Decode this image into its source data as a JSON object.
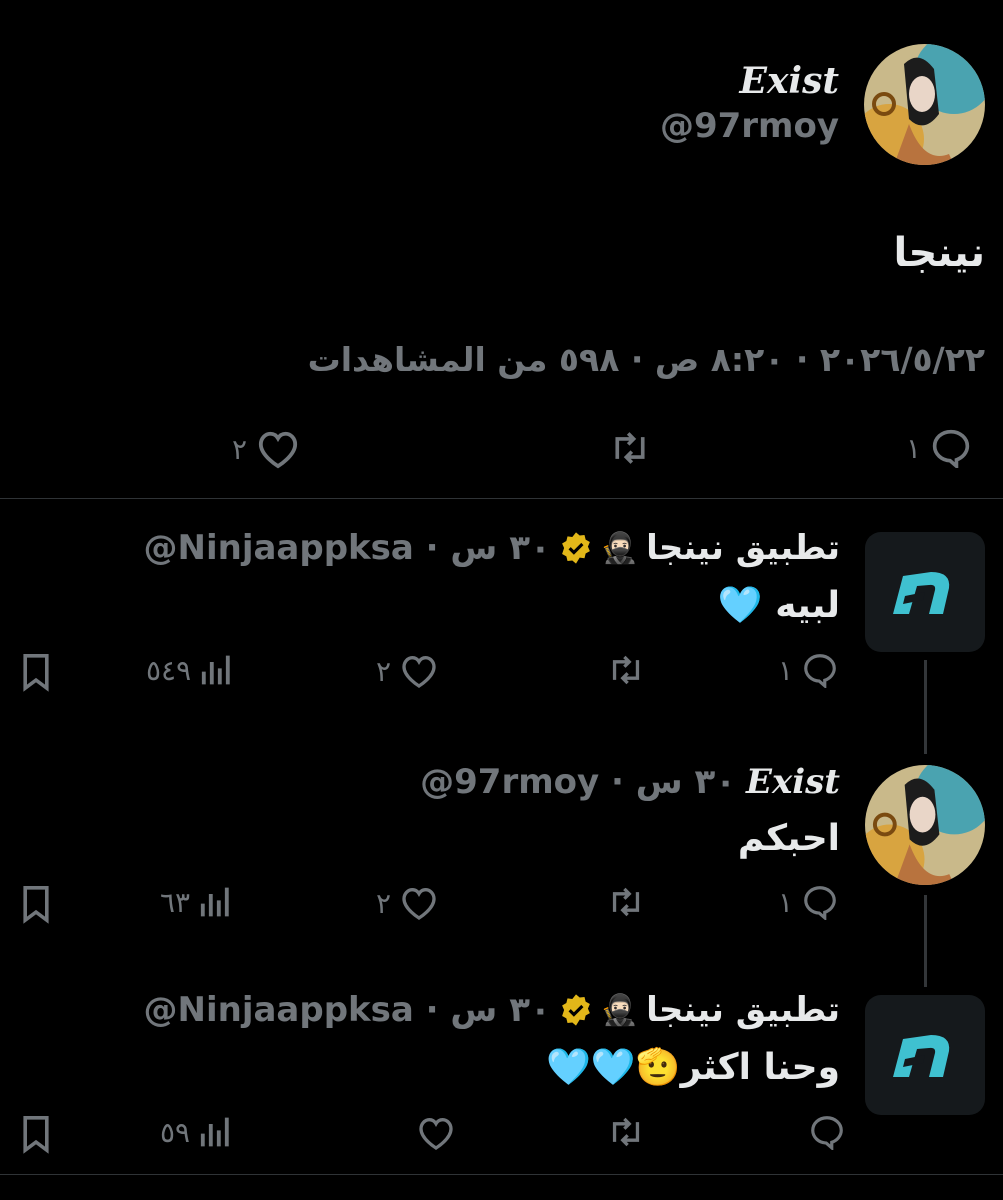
{
  "main_tweet": {
    "display_name": "Exist",
    "handle": "@97rmoy",
    "text": "نينجا",
    "meta": "٢٠٢٦/٥/٢٢ · ٨:٢٠ ص · ٥٩٨ من المشاهدات",
    "replies": "١",
    "likes": "٢"
  },
  "replies": [
    {
      "name": "تطبيق نينجا",
      "emoji": "🥷🏻",
      "handle_time": "@Ninjaappksa · ٣٠ س",
      "text": "لبيه 🩵",
      "replies": "١",
      "likes": "٢",
      "views": "٥٤٩"
    },
    {
      "name": "Exist",
      "handle_time": "@97rmoy · ٣٠ س",
      "text": "احبكم",
      "replies": "١",
      "likes": "٢",
      "views": "٦٣"
    },
    {
      "name": "تطبيق نينجا",
      "emoji": "🥷🏻",
      "handle_time": "@Ninjaappksa · ٣٠ س",
      "text": "وحنا اكثر🫡🩵🩵",
      "replies": "",
      "likes": "",
      "views": "٥٩"
    }
  ],
  "colors": {
    "background": "#000000",
    "text": "#e7e9ea",
    "secondary": "#71767b",
    "verified_gold": "#e2b719",
    "ninja_teal": "#3fc1d0"
  }
}
